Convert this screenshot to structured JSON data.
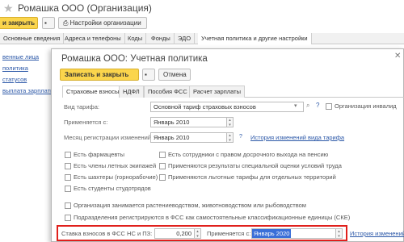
{
  "window": {
    "title": "Ромашка ООО (Организация)"
  },
  "toolbar": {
    "write_close": "и закрыть",
    "org_settings": "Настройки организации"
  },
  "main_tabs": [
    "Основные сведения",
    "Адреса и телефоны",
    "Коды",
    "Фонды",
    "ЭДО",
    "Учетная политика и другие настройки"
  ],
  "sidebar": {
    "links": [
      "венные лица",
      "политика",
      "статусов",
      "выплата зарплаты"
    ]
  },
  "dialog": {
    "title": "Ромашка ООО: Учетная политика",
    "write_close": "Записать и закрыть",
    "cancel": "Отмена",
    "tabs": [
      "Страховые взносы",
      "НДФЛ",
      "Пособия ФСС",
      "Расчет зарплаты"
    ],
    "tariff_label": "Вид тарифа:",
    "tariff_value": "Основной тариф страховых взносов",
    "invalid_org_label": "Организация инвалид",
    "applies_from_label": "Применяется с:",
    "applies_from_value": "Январь 2010",
    "month_reg_label": "Месяц регистрации изменений:",
    "month_reg_value": "Январь 2010",
    "history_link": "История изменений вида тарифа",
    "checkboxes_left": [
      "Есть фармацевты",
      "Есть члены летных экипажей",
      "Есть шахтеры (горнорабочие)",
      "Есть студенты студотрядов"
    ],
    "checkboxes_right": [
      "Есть сотрудники с правом досрочного выхода на пенсию",
      "Применяются результаты специальной оценки условий труда",
      "Применяются льготные тарифы для отдельных территорий"
    ],
    "checkbox_agri": "Организация занимается растениеводством, животноводством или рыбоводством",
    "checkbox_fss": "Подразделения регистрируются в ФСС как самостоятельные классификационные единицы (СКЕ)",
    "rate_label": "Ставка взносов в ФСС НС и ПЗ:",
    "rate_value": "0,200",
    "rate_applies_label": "Применяется с:",
    "rate_applies_value": "Январь 2020",
    "rate_history_link": "История изменений"
  },
  "colors": {
    "accent": "#fbd54c",
    "highlight": "#e0201c",
    "link": "#2c58a8"
  }
}
